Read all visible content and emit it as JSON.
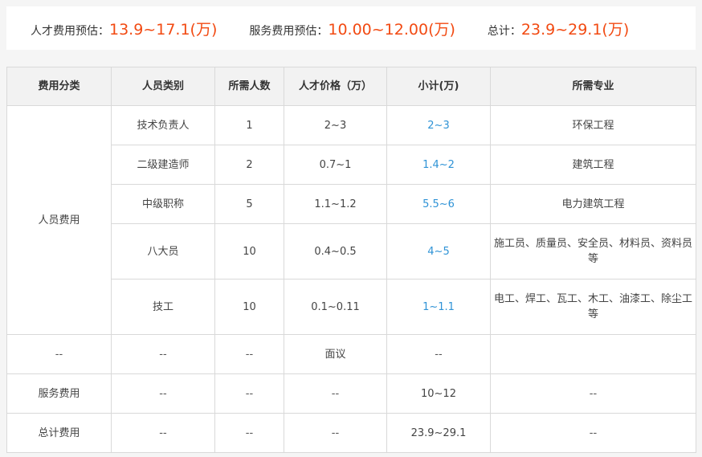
{
  "summary": {
    "talent_label": "人才费用预估：",
    "talent_value": "13.9~17.1(万)",
    "service_label": "服务费用预估：",
    "service_value": "10.00~12.00(万)",
    "total_label": "总计：",
    "total_value": "23.9~29.1(万)"
  },
  "table": {
    "headers": [
      "费用分类",
      "人员类别",
      "所需人数",
      "人才价格（万）",
      "小计(万)",
      "所需专业"
    ],
    "personnel_category": "人员费用",
    "personnel_rows": [
      {
        "type": "技术负责人",
        "count": "1",
        "price": "2~3",
        "subtotal": "2~3",
        "major": "环保工程"
      },
      {
        "type": "二级建造师",
        "count": "2",
        "price": "0.7~1",
        "subtotal": "1.4~2",
        "major": "建筑工程"
      },
      {
        "type": "中级职称",
        "count": "5",
        "price": "1.1~1.2",
        "subtotal": "5.5~6",
        "major": "电力建筑工程"
      },
      {
        "type": "八大员",
        "count": "10",
        "price": "0.4~0.5",
        "subtotal": "4~5",
        "major": "施工员、质量员、安全员、材料员、资料员等"
      },
      {
        "type": "技工",
        "count": "10",
        "price": "0.1~0.11",
        "subtotal": "1~1.1",
        "major": "电工、焊工、瓦工、木工、油漆工、除尘工等"
      }
    ],
    "other_row": {
      "category": "--",
      "type": "--",
      "count": "--",
      "price": "面议",
      "subtotal": "--",
      "major": ""
    },
    "service_row": {
      "category": "服务费用",
      "type": "--",
      "count": "--",
      "price": "--",
      "subtotal": "10~12",
      "major": "--"
    },
    "total_row": {
      "category": "总计费用",
      "type": "--",
      "count": "--",
      "price": "--",
      "subtotal": "23.9~29.1",
      "major": "--"
    }
  }
}
